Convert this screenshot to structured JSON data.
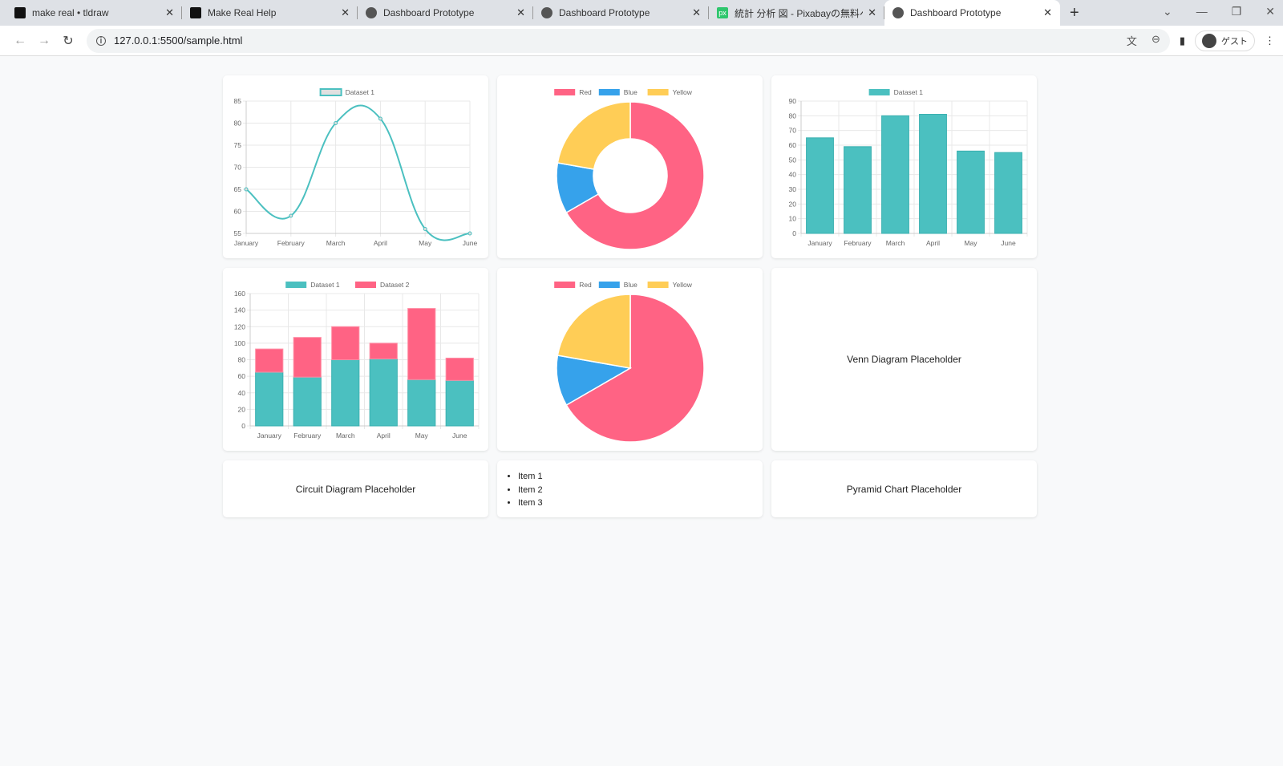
{
  "browser": {
    "tabs": [
      {
        "title": "make real • tldraw",
        "icon": "tldraw-icon"
      },
      {
        "title": "Make Real Help",
        "icon": "tldraw-icon"
      },
      {
        "title": "Dashboard Prototype",
        "icon": "globe-icon"
      },
      {
        "title": "Dashboard Prototype",
        "icon": "globe-icon"
      },
      {
        "title": "統計 分析 図 - Pixabayの無料ベクター",
        "icon": "pixabay-icon",
        "icon_text": "px"
      },
      {
        "title": "Dashboard Prototype",
        "icon": "globe-icon",
        "active": true
      }
    ],
    "url": "127.0.0.1:5500/sample.html",
    "profile_label": "ゲスト"
  },
  "colors": {
    "teal": "#4bc0c0",
    "red": "#ff6384",
    "blue": "#36a2eb",
    "yellow": "#ffcd56"
  },
  "chart_data": [
    {
      "type": "line",
      "legend": [
        "Dataset 1"
      ],
      "categories": [
        "January",
        "February",
        "March",
        "April",
        "May",
        "June"
      ],
      "series": [
        {
          "name": "Dataset 1",
          "values": [
            65,
            59,
            80,
            81,
            56,
            55
          ]
        }
      ],
      "ylim": [
        55,
        85
      ],
      "yticks": [
        55,
        60,
        65,
        70,
        75,
        80,
        85
      ],
      "grid": true,
      "legend_position": "top"
    },
    {
      "type": "doughnut",
      "labels": [
        "Red",
        "Blue",
        "Yellow"
      ],
      "values": [
        300,
        50,
        100
      ],
      "legend_position": "top"
    },
    {
      "type": "bar",
      "legend": [
        "Dataset 1"
      ],
      "categories": [
        "January",
        "February",
        "March",
        "April",
        "May",
        "June"
      ],
      "series": [
        {
          "name": "Dataset 1",
          "values": [
            65,
            59,
            80,
            81,
            56,
            55
          ]
        }
      ],
      "ylim": [
        0,
        90
      ],
      "yticks": [
        0,
        10,
        20,
        30,
        40,
        50,
        60,
        70,
        80,
        90
      ],
      "grid": true,
      "legend_position": "top"
    },
    {
      "type": "bar",
      "stacked": true,
      "legend": [
        "Dataset 1",
        "Dataset 2"
      ],
      "categories": [
        "January",
        "February",
        "March",
        "April",
        "May",
        "June"
      ],
      "series": [
        {
          "name": "Dataset 1",
          "values": [
            65,
            59,
            80,
            81,
            56,
            55
          ]
        },
        {
          "name": "Dataset 2",
          "values": [
            28,
            48,
            40,
            19,
            86,
            27
          ]
        }
      ],
      "ylim": [
        0,
        160
      ],
      "yticks": [
        0,
        20,
        40,
        60,
        80,
        100,
        120,
        140,
        160
      ],
      "grid": true,
      "legend_position": "top"
    },
    {
      "type": "pie",
      "labels": [
        "Red",
        "Blue",
        "Yellow"
      ],
      "values": [
        300,
        50,
        100
      ],
      "legend_position": "top"
    }
  ],
  "placeholders": {
    "venn": "Venn Diagram Placeholder",
    "circuit": "Circuit Diagram Placeholder",
    "pyramid": "Pyramid Chart Placeholder"
  },
  "list": [
    "Item 1",
    "Item 2",
    "Item 3"
  ]
}
